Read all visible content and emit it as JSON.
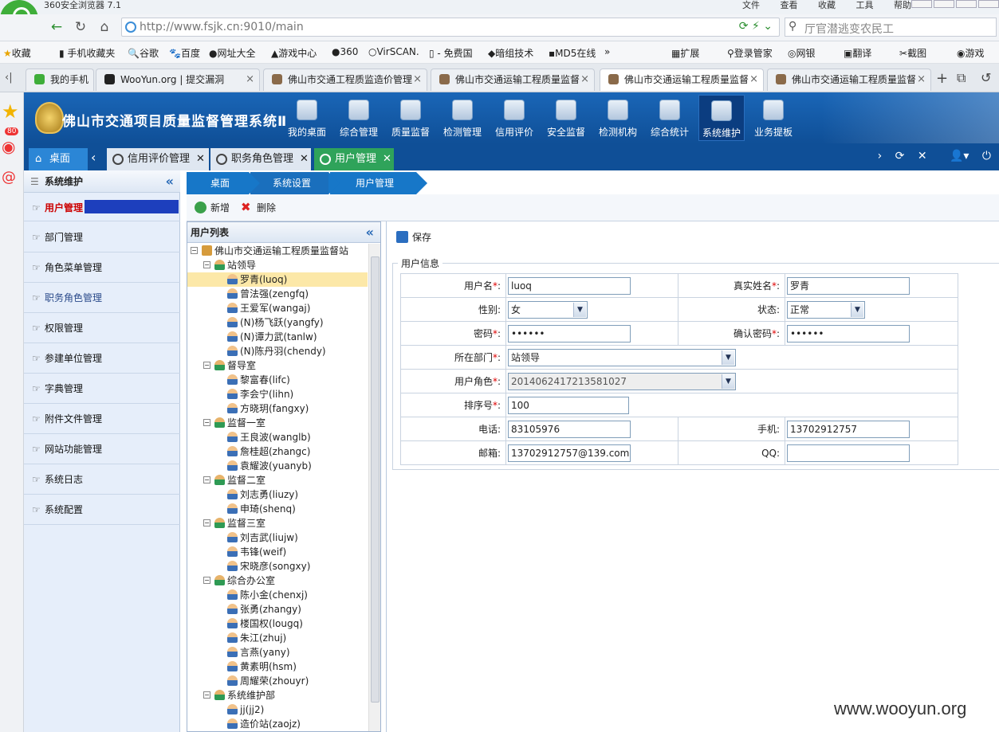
{
  "browser": {
    "title": "360安全浏览器 7.1",
    "menu": [
      "文件",
      "查看",
      "收藏",
      "工具",
      "帮助"
    ],
    "url": "http://www.fsjk.cn:9010/main",
    "search_placeholder": "厅官潜逃变农民工",
    "bookmarks": [
      "收藏",
      "手机收藏夹",
      "谷歌",
      "百度",
      "网址大全",
      "游戏中心",
      "360",
      "VirSCAN.",
      "- 免费国",
      "暗组技术",
      "MD5在线",
      "»",
      "扩展",
      "登录管家",
      "网银",
      "翻译",
      "截图",
      "游戏"
    ],
    "tabs": [
      "我的手机",
      "WooYun.org | 提交漏洞",
      "佛山市交通工程质监造价管理",
      "佛山市交通运输工程质量监督",
      "佛山市交通运输工程质量监督",
      "佛山市交通运输工程质量监督"
    ],
    "side_badge": "80"
  },
  "app": {
    "title": "佛山市交通项目质量监督管理系统Ⅱ",
    "nav": [
      "我的桌面",
      "综合管理",
      "质量监督",
      "检测管理",
      "信用评价",
      "安全监督",
      "检测机构",
      "综合统计",
      "系统维护",
      "业务提板"
    ],
    "tabs": {
      "home": "桌面",
      "t1": "信用评价管理",
      "t2": "职务角色管理",
      "t3": "用户管理"
    },
    "sidebar": {
      "header": "系统维护",
      "items": [
        "用户管理",
        "部门管理",
        "角色菜单管理",
        "职务角色管理",
        "权限管理",
        "参建单位管理",
        "字典管理",
        "附件文件管理",
        "网站功能管理",
        "系统日志",
        "系统配置"
      ]
    },
    "breadcrumb": [
      "桌面",
      "系统设置",
      "用户管理"
    ],
    "toolbar": {
      "add": "新增",
      "delete": "删除",
      "save": "保存"
    },
    "tree": {
      "title": "用户列表",
      "nodes": [
        {
          "t": "root",
          "label": "佛山市交通运输工程质量监督站"
        },
        {
          "t": "grp",
          "label": "站领导"
        },
        {
          "t": "user",
          "label": "罗青(luoq)",
          "sel": true
        },
        {
          "t": "user",
          "label": "曾法强(zengfq)"
        },
        {
          "t": "user",
          "label": "王爱军(wangaj)"
        },
        {
          "t": "user",
          "label": "(N)杨飞跃(yangfy)"
        },
        {
          "t": "user",
          "label": "(N)谭力武(tanlw)"
        },
        {
          "t": "user",
          "label": "(N)陈丹羽(chendy)"
        },
        {
          "t": "grp",
          "label": "督导室"
        },
        {
          "t": "user",
          "label": "黎富春(lifc)"
        },
        {
          "t": "user",
          "label": "李会宁(lihn)"
        },
        {
          "t": "user",
          "label": "方晓玥(fangxy)"
        },
        {
          "t": "grp",
          "label": "监督一室"
        },
        {
          "t": "user",
          "label": "王良波(wanglb)"
        },
        {
          "t": "user",
          "label": "詹桂超(zhangc)"
        },
        {
          "t": "user",
          "label": "袁耀波(yuanyb)"
        },
        {
          "t": "grp",
          "label": "监督二室"
        },
        {
          "t": "user",
          "label": "刘志勇(liuzy)"
        },
        {
          "t": "user",
          "label": "申琦(shenq)"
        },
        {
          "t": "grp",
          "label": "监督三室"
        },
        {
          "t": "user",
          "label": "刘吉武(liujw)"
        },
        {
          "t": "user",
          "label": "韦锋(weif)"
        },
        {
          "t": "user",
          "label": "宋晓彦(songxy)"
        },
        {
          "t": "grp",
          "label": "综合办公室"
        },
        {
          "t": "user",
          "label": "陈小金(chenxj)"
        },
        {
          "t": "user",
          "label": "张勇(zhangy)"
        },
        {
          "t": "user",
          "label": "楼国权(lougq)"
        },
        {
          "t": "user",
          "label": "朱江(zhuj)"
        },
        {
          "t": "user",
          "label": "言燕(yany)"
        },
        {
          "t": "user",
          "label": "黄素明(hsm)"
        },
        {
          "t": "user",
          "label": "周耀荣(zhouyr)"
        },
        {
          "t": "grp",
          "label": "系统维护部"
        },
        {
          "t": "user",
          "label": "jj(jj2)"
        },
        {
          "t": "user",
          "label": "造价站(zaojz)"
        }
      ]
    },
    "form": {
      "legend": "用户信息",
      "labels": {
        "username": "用户名",
        "realname": "真实姓名",
        "gender": "性别",
        "status": "状态",
        "password": "密码",
        "confirm": "确认密码",
        "dept": "所在部门",
        "role": "用户角色",
        "order": "排序号",
        "phone": "电话",
        "mobile": "手机",
        "email": "邮箱",
        "qq": "QQ:"
      },
      "values": {
        "username": "luoq",
        "realname": "罗青",
        "gender": "女",
        "status": "正常",
        "password": "••••••",
        "confirm": "••••••",
        "dept": "站领导",
        "role": "20140624172135810​27",
        "order": "100",
        "phone": "83105976",
        "mobile": "13702912757",
        "email": "13702912757@139.com",
        "qq": ""
      }
    }
  },
  "watermark": "www.wooyun.org"
}
